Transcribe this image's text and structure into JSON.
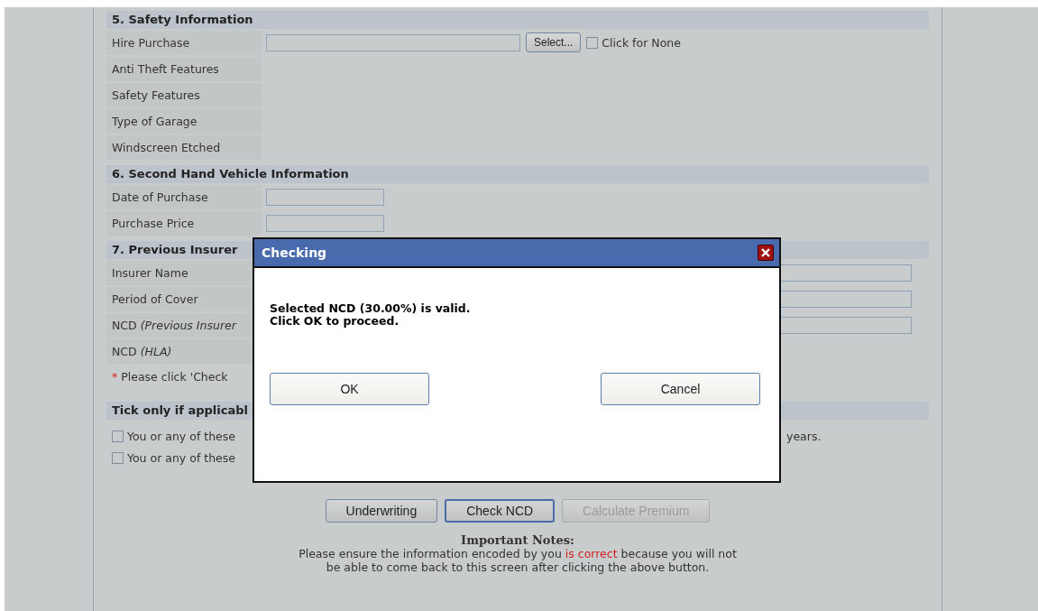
{
  "sections": [
    {
      "title": "5. Safety Information",
      "rows": [
        {
          "label": "Hire Purchase",
          "kind": "select",
          "button": "Select...",
          "checkbox_label": "Click for None",
          "checked": false
        },
        {
          "label": "Anti Theft Features",
          "kind": "plain"
        },
        {
          "label": "Safety Features",
          "kind": "plain"
        },
        {
          "label": "Type of Garage",
          "kind": "plain"
        },
        {
          "label": "Windscreen Etched",
          "kind": "plain"
        }
      ]
    },
    {
      "title": "6. Second Hand Vehicle Information",
      "rows": [
        {
          "label": "Date of Purchase",
          "kind": "short"
        },
        {
          "label": "Purchase Price",
          "kind": "short"
        }
      ]
    },
    {
      "title": "7. Previous Insurer",
      "rows": [
        {
          "label": "Insurer Name",
          "kind": "long"
        },
        {
          "label": "Period of Cover",
          "kind": "long"
        },
        {
          "label": "NCD *(Previous Insurer*",
          "kind": "long"
        },
        {
          "label": "NCD *(HLA)*",
          "kind": "plain"
        }
      ],
      "note_marker": "*",
      "note": "Please click 'Check"
    }
  ],
  "tick_section": {
    "title": "Tick only if applicabl",
    "items": [
      {
        "text": "You or any of these",
        "tail": "years.",
        "checked": false
      },
      {
        "text": "You or any of these",
        "checked": false
      }
    ]
  },
  "actions": [
    {
      "label": "Underwriting",
      "disabled": false,
      "focused": false
    },
    {
      "label": "Check NCD",
      "disabled": false,
      "focused": true
    },
    {
      "label": "Calculate Premium",
      "disabled": true,
      "focused": false
    }
  ],
  "notes": {
    "title": "Important Notes:",
    "parts": [
      {
        "text": "Please ensure the information encoded by you ",
        "highlight": false
      },
      {
        "text": "is correct",
        "highlight": true
      },
      {
        "text": " because you will not be able to come back to this screen after clicking the above button.",
        "highlight": false
      }
    ]
  },
  "dialog": {
    "title": "Checking",
    "message": [
      "Selected NCD (30.00%) is valid.",
      "Click OK to proceed."
    ],
    "buttons": [
      "OK",
      "Cancel"
    ]
  }
}
